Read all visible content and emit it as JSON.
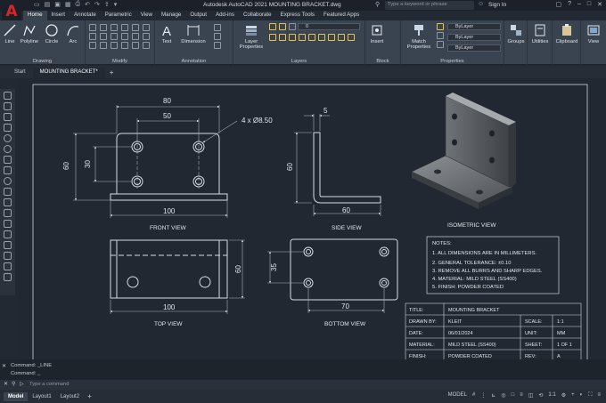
{
  "app": {
    "title": "Autodesk AutoCAD 2021   MOUNTING BRACKET.dwg",
    "search_placeholder": "Type a keyword or phrase",
    "sign_in": "Sign In",
    "logo": "A"
  },
  "ribbon_tabs": [
    "Home",
    "Insert",
    "Annotate",
    "Parametric",
    "View",
    "Manage",
    "Output",
    "Add-ins",
    "Collaborate",
    "Express Tools",
    "Featured Apps"
  ],
  "ribbon": {
    "draw": {
      "line": "Line",
      "polyline": "Polyline",
      "circle": "Circle",
      "arc": "Arc",
      "label": "Drawing"
    },
    "modify_label": "Modify",
    "annotation": {
      "text": "Text",
      "dimension": "Dimension",
      "label": "Annotation"
    },
    "layers": {
      "properties": "Layer\nProperties",
      "current": "0",
      "label": "Layers"
    },
    "block": {
      "insert": "Insert",
      "label": "Block"
    },
    "properties": {
      "match": "Match\nProperties",
      "bylayer1": "ByLayer",
      "bylayer2": "ByLayer",
      "bylayer3": "ByLayer",
      "label": "Properties"
    },
    "groups": "Groups",
    "utilities": "Utilities",
    "clipboard": "Clipboard",
    "view": "View"
  },
  "doc_tabs": [
    "Start",
    "MOUNTING BRACKET*"
  ],
  "drawing": {
    "front": {
      "label": "FRONT VIEW",
      "d80": "80",
      "d50": "50",
      "d60": "60",
      "d30": "30",
      "d100": "100",
      "hole_callout": "4 x Ø8.50"
    },
    "side": {
      "label": "SIDE VIEW",
      "d5": "5",
      "d60": "60",
      "d60b": "60"
    },
    "iso": {
      "label": "ISOMETRIC VIEW"
    },
    "top": {
      "label": "TOP VIEW",
      "d100": "100",
      "d60": "60"
    },
    "bottom": {
      "label": "BOTTOM VIEW",
      "d35": "35",
      "d70": "70"
    },
    "notes": {
      "title": "NOTES:",
      "items": [
        "1.  ALL DIMENSIONS ARE IN MILLIMETERS.",
        "2.  GENERAL TOLERANCE: ±0.10",
        "3.  REMOVE ALL BURRS AND SHARP EDGES.",
        "4.  MATERIAL: MILD STEEL (SS400)",
        "5.  FINISH: POWDER COATED"
      ]
    },
    "titleblock": {
      "title_k": "TITLE:",
      "title_v": "MOUNTING BRACKET",
      "drawn_k": "DRAWN BY:",
      "drawn_v": "KLEIT",
      "scale_k": "SCALE:",
      "scale_v": "1:1",
      "date_k": "DATE:",
      "date_v": "06/01/2024",
      "unit_k": "UNIT:",
      "unit_v": "MM",
      "material_k": "MATERIAL:",
      "material_v": "MILD STEEL (SS400)",
      "sheet_k": "SHEET:",
      "sheet_v": "1 OF 1",
      "finish_k": "FINISH:",
      "finish_v": "POWDER COATED",
      "rev_k": "REV:",
      "rev_v": "A"
    }
  },
  "command": {
    "history1": "Command:  _LINE",
    "history2": "Command:  _",
    "prompt": "Type a command"
  },
  "status": {
    "layouts": [
      "Model",
      "Layout1",
      "Layout2"
    ],
    "model": "MODEL",
    "scale": "1:1"
  }
}
